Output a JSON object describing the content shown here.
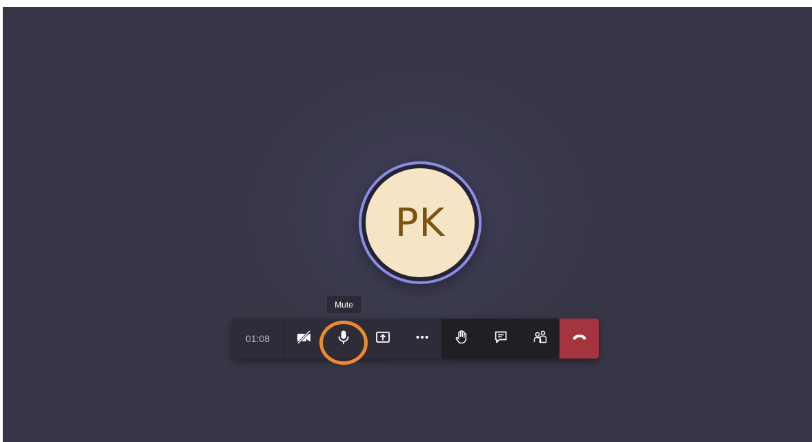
{
  "participant": {
    "initials": "PK"
  },
  "tooltip": {
    "text": "Mute"
  },
  "toolbar": {
    "timer": "01:08",
    "buttons": [
      {
        "name": "camera-off",
        "icon": "camera-off-icon"
      },
      {
        "name": "mute",
        "icon": "microphone-icon"
      },
      {
        "name": "share",
        "icon": "share-screen-icon"
      },
      {
        "name": "more",
        "icon": "more-options-icon"
      },
      {
        "name": "raise-hand",
        "icon": "raise-hand-icon"
      },
      {
        "name": "chat",
        "icon": "chat-icon"
      },
      {
        "name": "participants",
        "icon": "participants-icon"
      },
      {
        "name": "hang-up",
        "icon": "hang-up-icon"
      }
    ]
  },
  "colors": {
    "background": "#373646",
    "avatar_ring": "#8b8ce6",
    "avatar_fill": "#f5e5c5",
    "avatar_text": "#7a5410",
    "hangup": "#a4343e",
    "highlight": "#f0892c"
  }
}
